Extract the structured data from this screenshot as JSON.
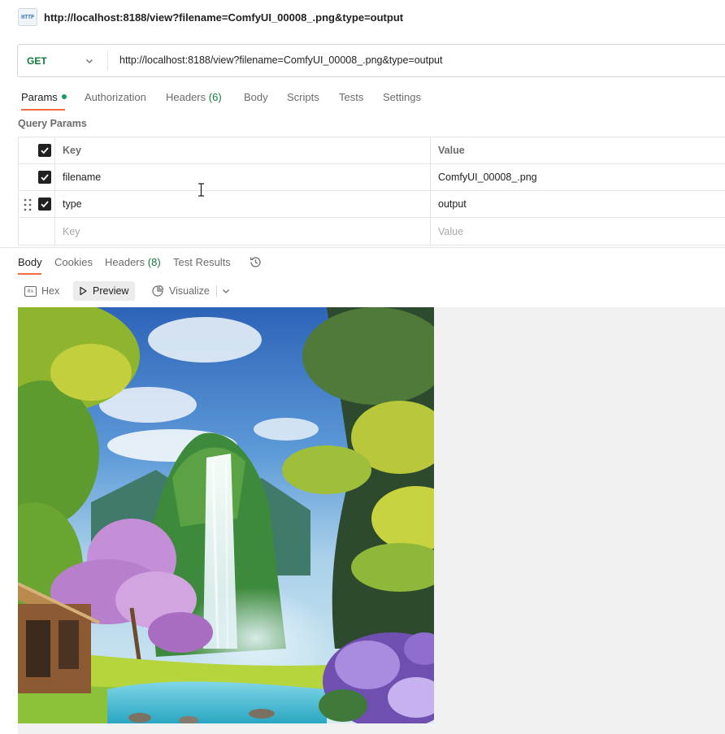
{
  "request": {
    "title": "http://localhost:8188/view?filename=ComfyUI_00008_.png&type=output",
    "method": "GET",
    "url": "http://localhost:8188/view?filename=ComfyUI_00008_.png&type=output"
  },
  "request_tabs": [
    {
      "label": "Params",
      "active": true,
      "has_dot": true
    },
    {
      "label": "Authorization"
    },
    {
      "label": "Headers",
      "count": "(6)"
    },
    {
      "label": "Body"
    },
    {
      "label": "Scripts"
    },
    {
      "label": "Tests"
    },
    {
      "label": "Settings"
    }
  ],
  "query_params": {
    "section_label": "Query Params",
    "header": {
      "key": "Key",
      "value": "Value"
    },
    "rows": [
      {
        "key": "filename",
        "value": "ComfyUI_00008_.png",
        "checked": true
      },
      {
        "key": "type",
        "value": "output",
        "checked": true
      }
    ],
    "placeholder": {
      "key": "Key",
      "value": "Value"
    }
  },
  "response_tabs": [
    {
      "label": "Body",
      "active": true
    },
    {
      "label": "Cookies"
    },
    {
      "label": "Headers",
      "count": "(8)"
    },
    {
      "label": "Test Results"
    }
  ],
  "response_toolbar": {
    "hex": "Hex",
    "hex_icon_text": "0x",
    "preview": "Preview",
    "visualize": "Visualize"
  },
  "colors": {
    "accent_underline": "#f26b3a",
    "method_get": "#0f7a3a",
    "status_dot": "#0f9d58"
  }
}
